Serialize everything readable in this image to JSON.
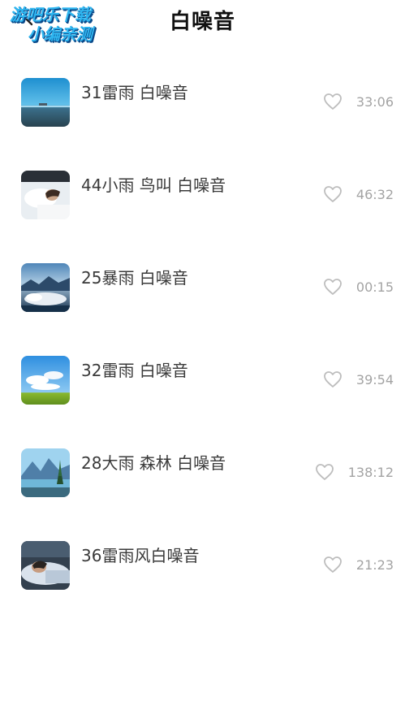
{
  "header": {
    "title": "白噪音",
    "back_icon": "back-arrow-icon"
  },
  "watermark": {
    "line1": "游吧乐下载",
    "line2": "小编亲测"
  },
  "tracks": [
    {
      "title": "31雷雨 白噪音",
      "duration": "33:06",
      "liked": false,
      "thumb": "lake-horizon"
    },
    {
      "title": "44小雨 鸟叫 白噪音",
      "duration": "46:32",
      "liked": false,
      "thumb": "sleeping-person-pillow"
    },
    {
      "title": "25暴雨 白噪音",
      "duration": "00:15",
      "liked": false,
      "thumb": "clouds-over-mountains"
    },
    {
      "title": "32雷雨 白噪音",
      "duration": "39:54",
      "liked": false,
      "thumb": "blue-sky-grass"
    },
    {
      "title": "28大雨 森林 白噪音",
      "duration": "138:12",
      "liked": false,
      "thumb": "mountain-lake-forest"
    },
    {
      "title": "36雷雨风白噪音",
      "duration": "21:23",
      "liked": false,
      "thumb": "sleeping-person-bed"
    }
  ],
  "colors": {
    "title_text": "#111111",
    "track_text": "#3a3a3a",
    "duration_text": "#a3a3a3",
    "heart_stroke": "#bdbdbd",
    "watermark": "#2fb6f0"
  }
}
